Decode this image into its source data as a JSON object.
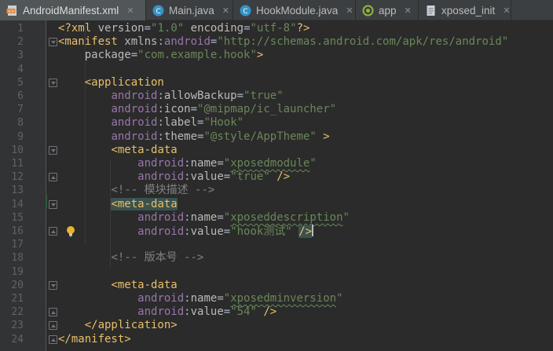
{
  "tabs": [
    {
      "label": "AndroidManifest.xml",
      "icon": "xml-file-icon",
      "active": true
    },
    {
      "label": "Main.java",
      "icon": "java-class-icon",
      "active": false
    },
    {
      "label": "HookModule.java",
      "icon": "java-class-icon",
      "active": false
    },
    {
      "label": "app",
      "icon": "android-module-icon",
      "active": false
    },
    {
      "label": "xposed_init",
      "icon": "text-file-icon",
      "active": false
    }
  ],
  "close_glyph": "✕",
  "lines": [
    {
      "n": "1"
    },
    {
      "n": "2"
    },
    {
      "n": "3"
    },
    {
      "n": "4"
    },
    {
      "n": "5"
    },
    {
      "n": "6"
    },
    {
      "n": "7"
    },
    {
      "n": "8"
    },
    {
      "n": "9"
    },
    {
      "n": "10"
    },
    {
      "n": "11"
    },
    {
      "n": "12"
    },
    {
      "n": "13"
    },
    {
      "n": "14"
    },
    {
      "n": "15"
    },
    {
      "n": "16"
    },
    {
      "n": "17"
    },
    {
      "n": "18"
    },
    {
      "n": "19"
    },
    {
      "n": "20"
    },
    {
      "n": "21"
    },
    {
      "n": "22"
    },
    {
      "n": "23"
    },
    {
      "n": "24"
    }
  ],
  "code": {
    "l1": {
      "pi_open": "<?xml",
      "version_attr": "version",
      "version_val": "\"1.0\"",
      "enc_attr": "encoding",
      "enc_val": "\"utf-8\"",
      "pi_close": "?>"
    },
    "l2": {
      "open": "<manifest",
      "ns_prefix": "xmlns",
      "ns_name": "android",
      "ns_val": "\"http://schemas.android.com/apk/res/android\""
    },
    "l3": {
      "attr": "package",
      "val": "\"com.example.hook\"",
      "close": ">"
    },
    "l5": {
      "open": "<application"
    },
    "l6": {
      "ns": "android",
      "attr": "allowBackup",
      "val": "\"true\""
    },
    "l7": {
      "ns": "android",
      "attr": "icon",
      "val": "\"@mipmap/ic_launcher\""
    },
    "l8": {
      "ns": "android",
      "attr": "label",
      "val": "\"Hook\""
    },
    "l9": {
      "ns": "android",
      "attr": "theme",
      "val": "\"@style/AppTheme\"",
      "close": ">"
    },
    "l10": {
      "open": "<meta-data"
    },
    "l11": {
      "ns": "android",
      "attr": "name",
      "q1": "\"",
      "val": "xposedmodule",
      "q2": "\""
    },
    "l12": {
      "ns": "android",
      "attr": "value",
      "val": "\"true\"",
      "close": "/>"
    },
    "l13": {
      "comment": "<!-- 模块描述 -->"
    },
    "l14": {
      "open": "<meta-data"
    },
    "l15": {
      "ns": "android",
      "attr": "name",
      "q1": "\"",
      "val": "xposeddescription",
      "q2": "\""
    },
    "l16": {
      "ns": "android",
      "attr": "value",
      "val": "\"hook测试\"",
      "close": "/>"
    },
    "l18": {
      "comment": "<!-- 版本号 -->"
    },
    "l20": {
      "open": "<meta-data"
    },
    "l21": {
      "ns": "android",
      "attr": "name",
      "q1": "\"",
      "val": "xposedminversion",
      "q2": "\""
    },
    "l22": {
      "ns": "android",
      "attr": "value",
      "val": "\"54\"",
      "close": "/>"
    },
    "l23": {
      "close_tag": "</application>"
    },
    "l24": {
      "close_tag": "</manifest>"
    }
  },
  "colors": {
    "background": "#2b2b2b",
    "gutter": "#313335",
    "tag": "#e8bf6a",
    "namespace": "#9876aa",
    "attribute": "#bababa",
    "value": "#6a8759",
    "comment": "#808080",
    "line_number": "#606366"
  }
}
